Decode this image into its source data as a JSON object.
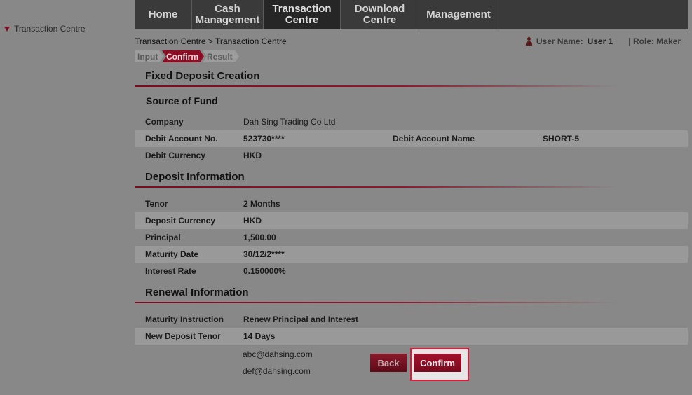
{
  "sidebar": {
    "items": [
      {
        "label": "Transaction Centre"
      }
    ]
  },
  "nav": {
    "tabs": [
      {
        "label": "Home"
      },
      {
        "label": "Cash\nManagement"
      },
      {
        "label": "Transaction\nCentre"
      },
      {
        "label": "Download\nCentre"
      },
      {
        "label": "Management"
      }
    ],
    "active_index": 2
  },
  "breadcrumb": "Transaction Centre > Transaction Centre",
  "user": {
    "name_label": "User Name:",
    "name_value": "User 1",
    "role_text": "| Role: Maker"
  },
  "steps": [
    "Input",
    "Confirm",
    "Result"
  ],
  "page_title": "Fixed Deposit Creation",
  "source_of_fund": {
    "title": "Source of Fund",
    "company_label": "Company",
    "company_value": "Dah Sing Trading Co Ltd",
    "debit_account_no_label": "Debit Account No.",
    "debit_account_no_value": "523730****",
    "debit_account_name_label": "Debit Account Name",
    "debit_account_name_value": "SHORT-5",
    "debit_currency_label": "Debit Currency",
    "debit_currency_value": "HKD"
  },
  "deposit_info": {
    "title": "Deposit Information",
    "rows": [
      {
        "label": "Tenor",
        "value": "2 Months"
      },
      {
        "label": "Deposit Currency",
        "value": "HKD"
      },
      {
        "label": "Principal",
        "value": "1,500.00"
      },
      {
        "label": "Maturity Date",
        "value": "30/12/2****"
      },
      {
        "label": "Interest Rate",
        "value": "0.150000%"
      }
    ]
  },
  "renewal_info": {
    "title": "Renewal Information",
    "rows": [
      {
        "label": "Maturity Instruction",
        "value": "Renew Principal and Interest"
      },
      {
        "label": "New Deposit Tenor",
        "value": "14 Days"
      }
    ]
  },
  "emails": [
    "abc@dahsing.com",
    "def@dahsing.com"
  ],
  "buttons": {
    "back": "Back",
    "confirm": "Confirm"
  },
  "colors": {
    "accent": "#8b0e24",
    "highlight_border": "#e3173a",
    "nav_bg": "#3a3a3a"
  }
}
